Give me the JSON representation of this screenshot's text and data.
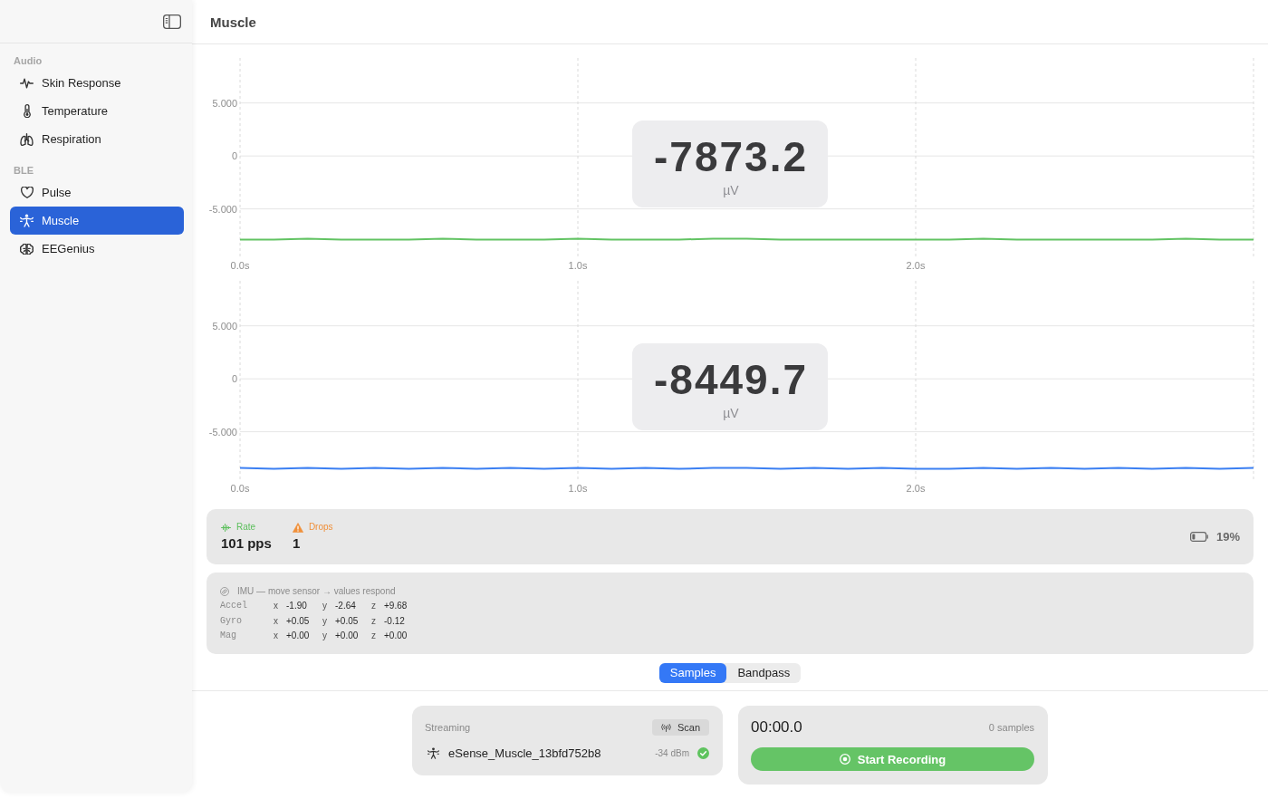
{
  "sidebar": {
    "sections": [
      {
        "title": "Audio",
        "items": [
          {
            "label": "Skin Response",
            "selected": false
          },
          {
            "label": "Temperature",
            "selected": false
          },
          {
            "label": "Respiration",
            "selected": false
          }
        ]
      },
      {
        "title": "BLE",
        "items": [
          {
            "label": "Pulse",
            "selected": false
          },
          {
            "label": "Muscle",
            "selected": true
          },
          {
            "label": "EEGenius",
            "selected": false
          }
        ]
      }
    ]
  },
  "header": {
    "title": "Muscle"
  },
  "charts": [
    {
      "readout": {
        "value": "-7873.2",
        "unit": "µV"
      },
      "chart_data": {
        "type": "line",
        "grid": true,
        "x": [
          0,
          0.1,
          0.2,
          0.3,
          0.4,
          0.5,
          0.6,
          0.7,
          0.8,
          0.9,
          1,
          1.1,
          1.2,
          1.3,
          1.4,
          1.5,
          1.6,
          1.7,
          1.8,
          1.9,
          2,
          2.1,
          2.2,
          2.3,
          2.4,
          2.5,
          2.6,
          2.7,
          2.8,
          2.9,
          3
        ],
        "series": [
          {
            "color": "#62c363",
            "values": [
              -7.9,
              -7.9,
              -7.8,
              -7.9,
              -7.9,
              -7.9,
              -7.8,
              -7.9,
              -7.9,
              -7.9,
              -7.8,
              -7.9,
              -7.9,
              -7.9,
              -7.8,
              -7.8,
              -7.9,
              -7.9,
              -7.9,
              -7.9,
              -7.9,
              -7.9,
              -7.8,
              -7.9,
              -7.9,
              -7.9,
              -7.9,
              -7.9,
              -7.8,
              -7.9,
              -7.9
            ]
          }
        ],
        "xlim": [
          0,
          3
        ],
        "ylim": [
          -9.65,
          9.25
        ],
        "xticks": [
          {
            "value": 0,
            "label": "0.0s"
          },
          {
            "value": 1,
            "label": "1.0s"
          },
          {
            "value": 2,
            "label": "2.0s"
          }
        ],
        "yticks": [
          {
            "value": 5,
            "label": "5.000"
          },
          {
            "value": 0,
            "label": "0"
          },
          {
            "value": -5,
            "label": "-5.000"
          }
        ]
      }
    },
    {
      "readout": {
        "value": "-8449.7",
        "unit": "µV"
      },
      "chart_data": {
        "type": "line",
        "grid": true,
        "x": [
          0,
          0.1,
          0.2,
          0.3,
          0.4,
          0.5,
          0.6,
          0.7,
          0.8,
          0.9,
          1,
          1.1,
          1.2,
          1.3,
          1.4,
          1.5,
          1.6,
          1.7,
          1.8,
          1.9,
          2,
          2.1,
          2.2,
          2.3,
          2.4,
          2.5,
          2.6,
          2.7,
          2.8,
          2.9,
          3
        ],
        "series": [
          {
            "color": "#3b7ff2",
            "values": [
              -8.4,
              -8.5,
              -8.4,
              -8.5,
              -8.4,
              -8.5,
              -8.4,
              -8.5,
              -8.4,
              -8.5,
              -8.4,
              -8.5,
              -8.4,
              -8.5,
              -8.4,
              -8.4,
              -8.5,
              -8.4,
              -8.5,
              -8.4,
              -8.5,
              -8.5,
              -8.4,
              -8.5,
              -8.4,
              -8.5,
              -8.4,
              -8.5,
              -8.4,
              -8.5,
              -8.4
            ]
          }
        ],
        "xlim": [
          0,
          3
        ],
        "ylim": [
          -9.65,
          9.25
        ],
        "xticks": [
          {
            "value": 0,
            "label": "0.0s"
          },
          {
            "value": 1,
            "label": "1.0s"
          },
          {
            "value": 2,
            "label": "2.0s"
          }
        ],
        "yticks": [
          {
            "value": 5,
            "label": "5.000"
          },
          {
            "value": 0,
            "label": "0"
          },
          {
            "value": -5,
            "label": "-5.000"
          }
        ]
      }
    }
  ],
  "stats": {
    "items": [
      {
        "label": "Rate",
        "value": "101 pps",
        "color": "#5cbf5c"
      },
      {
        "label": "Drops",
        "value": "1",
        "color": "#f0903a"
      }
    ],
    "battery": "19%"
  },
  "imu": {
    "title": "IMU — move sensor → values respond",
    "rows": [
      {
        "label": "Accel",
        "axes": [
          {
            "axis": "x",
            "value": "-1.90"
          },
          {
            "axis": "y",
            "value": "-2.64"
          },
          {
            "axis": "z",
            "value": "+9.68"
          }
        ]
      },
      {
        "label": "Gyro",
        "axes": [
          {
            "axis": "x",
            "value": "+0.05"
          },
          {
            "axis": "y",
            "value": "+0.05"
          },
          {
            "axis": "z",
            "value": "-0.12"
          }
        ]
      },
      {
        "label": "Mag",
        "axes": [
          {
            "axis": "x",
            "value": "+0.00"
          },
          {
            "axis": "y",
            "value": "+0.00"
          },
          {
            "axis": "z",
            "value": "+0.00"
          }
        ]
      }
    ]
  },
  "view_tabs": [
    {
      "label": "Samples",
      "selected": true
    },
    {
      "label": "Bandpass",
      "selected": false
    }
  ],
  "device": {
    "status": "Streaming",
    "scan_button": "Scan",
    "name": "eSense_Muscle_13bfd752b8",
    "signal": "-34 dBm",
    "connected": true
  },
  "recording": {
    "elapsed": "00:00.0",
    "samples": "0 samples",
    "button": "Start Recording"
  }
}
